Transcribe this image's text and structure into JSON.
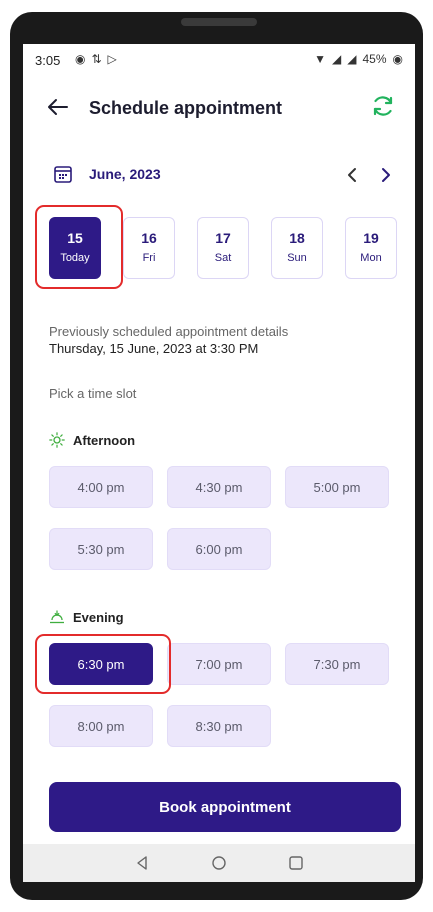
{
  "status_bar": {
    "time": "3:05",
    "battery": "45%"
  },
  "header": {
    "title": "Schedule appointment"
  },
  "calendar": {
    "month": "June, 2023"
  },
  "days": [
    {
      "num": "15",
      "label": "Today",
      "selected": true
    },
    {
      "num": "16",
      "label": "Fri"
    },
    {
      "num": "17",
      "label": "Sat"
    },
    {
      "num": "18",
      "label": "Sun"
    },
    {
      "num": "19",
      "label": "Mon"
    }
  ],
  "previous": {
    "label": "Previously scheduled appointment details",
    "value": "Thursday, 15 June, 2023 at 3:30 PM"
  },
  "pick_label": "Pick a time slot",
  "afternoon": {
    "name": "Afternoon",
    "slots": [
      "4:00 pm",
      "4:30 pm",
      "5:00 pm",
      "5:30 pm",
      "6:00 pm"
    ]
  },
  "evening": {
    "name": "Evening",
    "slots": [
      "6:30 pm",
      "7:00 pm",
      "7:30 pm",
      "8:00 pm",
      "8:30 pm"
    ],
    "selected": "6:30 pm"
  },
  "book_button": "Book appointment",
  "colors": {
    "primary": "#2e1a87",
    "slot_bg": "#ece7fb",
    "accent_green": "#22b35e",
    "annotation_red": "#e32b2b"
  }
}
